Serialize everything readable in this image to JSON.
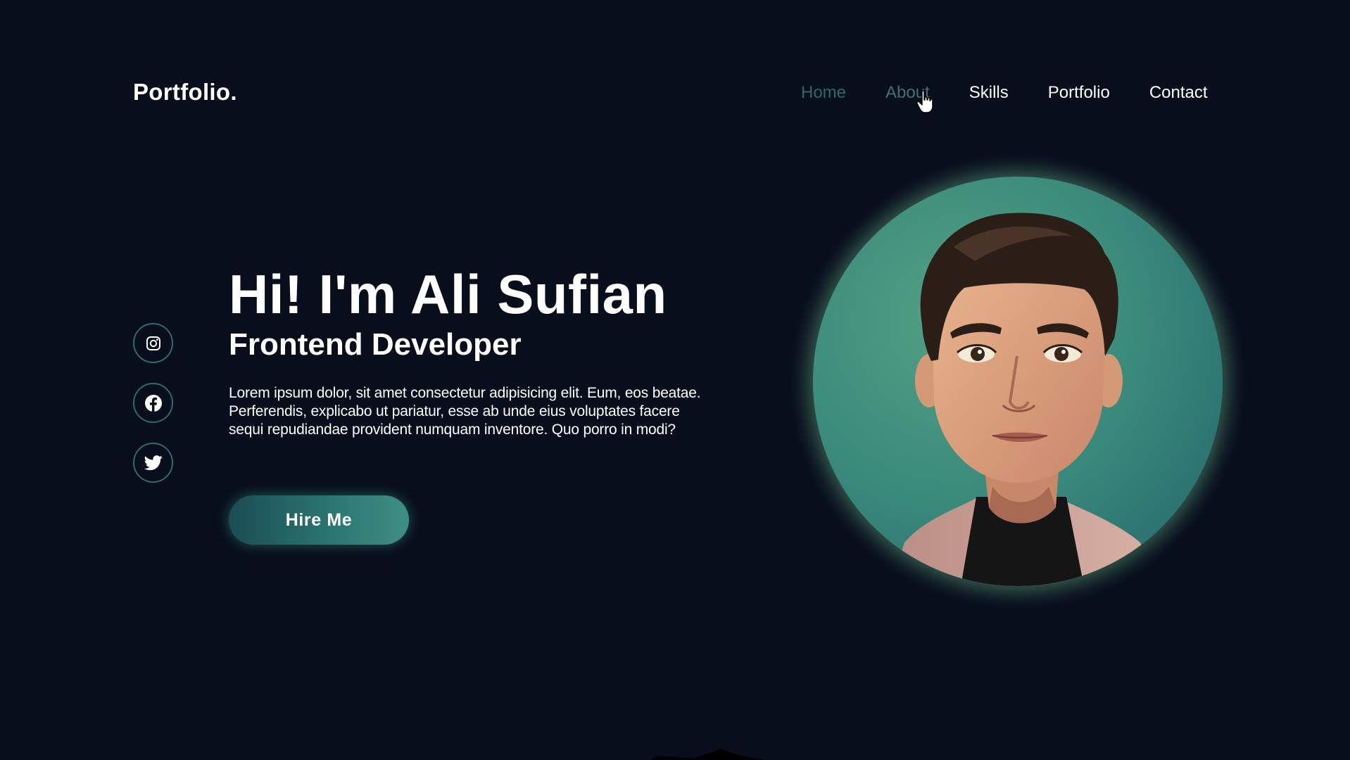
{
  "header": {
    "logo": "Portfolio.",
    "nav": [
      {
        "label": "Home",
        "state": "active"
      },
      {
        "label": "About",
        "state": "hover"
      },
      {
        "label": "Skills",
        "state": "default"
      },
      {
        "label": "Portfolio",
        "state": "default"
      },
      {
        "label": "Contact",
        "state": "default"
      }
    ]
  },
  "social": [
    {
      "icon": "instagram-icon"
    },
    {
      "icon": "facebook-icon"
    },
    {
      "icon": "twitter-icon"
    }
  ],
  "hero": {
    "title": "Hi! I'm Ali Sufian",
    "subtitle": "Frontend Developer",
    "description": "Lorem ipsum dolor, sit amet consectetur adipisicing elit. Eum, eos beatae. Perferendis, explicabo ut pariatur, esse ab unde eius voluptates facere sequi repudiandae provident numquam inventore. Quo porro in modi?",
    "button_label": "Hire Me"
  },
  "colors": {
    "background": "#080e1c",
    "accent": "#2f7872",
    "nav_active": "#2c6a66",
    "text": "#ffffff"
  }
}
